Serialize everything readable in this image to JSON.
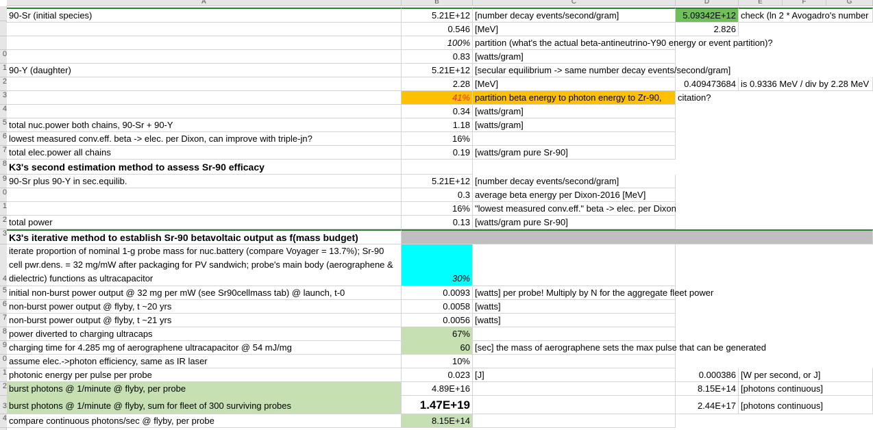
{
  "columns": [
    "A",
    "B",
    "C",
    "D",
    "E",
    "F",
    "G"
  ],
  "row_numbers": [
    "",
    "",
    "",
    "0",
    "1",
    "2",
    "3",
    "4",
    "5",
    "6",
    "7",
    "8",
    "9",
    "0",
    "1",
    "2",
    "3",
    "",
    "",
    "4",
    "5",
    "6",
    "7",
    "8",
    "9",
    "0",
    "1",
    "2",
    "3",
    "4"
  ],
  "rows": {
    "r1": {
      "a": "90-Sr (initial species)",
      "b": "5.21E+12",
      "c": "[number decay events/second/gram]",
      "d": "5.09342E+12",
      "e": "check (ln 2 * Avogadro's number"
    },
    "r2": {
      "b": "0.546",
      "c": "[MeV]",
      "d": "2.826"
    },
    "r3": {
      "b": "100%",
      "c": "partition (what's the actual beta-antineutrino-Y90 energy or event partition)?"
    },
    "r4": {
      "b": "0.83",
      "c": "[watts/gram]"
    },
    "r5": {
      "a": "90-Y (daughter)",
      "b": "5.21E+12",
      "c": "[secular equilibrium -> same number decay events/second/gram]"
    },
    "r6": {
      "b": "2.28",
      "c": "[MeV]",
      "d": "0.409473684",
      "e": "is 0.9336 MeV / div by 2.28 MeV"
    },
    "r7": {
      "b": "41%",
      "c": "partition beta energy to photon energy to Zr-90,",
      "c2": "citation?"
    },
    "r8": {
      "b": "0.34",
      "c": "[watts/gram]"
    },
    "r9": {
      "a": "total nuc.power both chains, 90-Sr + 90-Y",
      "b": "1.18",
      "c": "[watts/gram]"
    },
    "r10": {
      "a": "lowest measured conv.eff. beta -> elec. per Dixon, can improve with triple-jn?",
      "b": "16%"
    },
    "r11": {
      "a": "total elec.power all chains",
      "b": "0.19",
      "c": "[watts/gram pure Sr-90]"
    },
    "r12": {
      "a": "K3's second estimation method to assess Sr-90 efficacy"
    },
    "r13": {
      "a": "90-Sr plus 90-Y in sec.equilib.",
      "b": "5.21E+12",
      "c": "[number decay events/second/gram]"
    },
    "r14": {
      "b": "0.3",
      "c": "average beta energy per Dixon-2016 [MeV]"
    },
    "r15": {
      "b": "16%",
      "c": "\"lowest measured conv.eff.\" beta -> elec. per Dixon"
    },
    "r16": {
      "a": "total power",
      "b": "0.13",
      "c": "[watts/gram pure Sr-90]"
    },
    "r17": {
      "a": "K3's iterative method to establish Sr-90 betavoltaic output as f(mass budget)"
    },
    "r18": {
      "a": "iterate proportion of nominal 1-g probe mass for nuc.battery (compare Voyager = 13.7%); Sr-90 cell pwr.dens. = 32 mg/mW after packaging for PV sandwich; probe's main body (aerographene & dielectric) functions as ultracapacitor",
      "b": "30%"
    },
    "r19": {
      "a": "initial non-burst power output @ 32 mg per mW (see Sr90cellmass tab) @ launch, t-0",
      "b": "0.0093",
      "c": "[watts] per probe! Multiply by N for the aggregate fleet power"
    },
    "r20": {
      "a": "non-burst power output @ flyby, t ~20 yrs",
      "b": "0.0058",
      "c": "[watts]"
    },
    "r21": {
      "a": "non-burst power output @ flyby, t ~21 yrs",
      "b": "0.0056",
      "c": "[watts]"
    },
    "r22": {
      "a": "power diverted to charging ultracaps",
      "b": "67%"
    },
    "r23": {
      "a": "charging time for 4.285 mg of aerographene ultracapacitor @ 54 mJ/mg",
      "b": "60",
      "c": "[sec] the mass of aerographene sets the max pulse that can be generated"
    },
    "r24": {
      "a": "assume elec.->photon efficiency, same as IR laser",
      "b": "10%"
    },
    "r25": {
      "a": "photonic energy per pulse per probe",
      "b": "0.023",
      "c": "[J]",
      "d": "0.000386",
      "e": "[W per second, or J]"
    },
    "r26": {
      "a": "burst photons @ 1/minute @ flyby, per probe",
      "b": "4.89E+16",
      "d": "8.15E+14",
      "e": "[photons continuous]"
    },
    "r27": {
      "a": "burst photons @ 1/minute @ flyby, sum for fleet of 300 surviving probes",
      "b": "1.47E+19",
      "d": "2.44E+17",
      "e": "[photons continuous]"
    },
    "r28": {
      "a": "compare continuous photons/sec @ flyby, per probe",
      "b": "8.15E+14"
    }
  }
}
